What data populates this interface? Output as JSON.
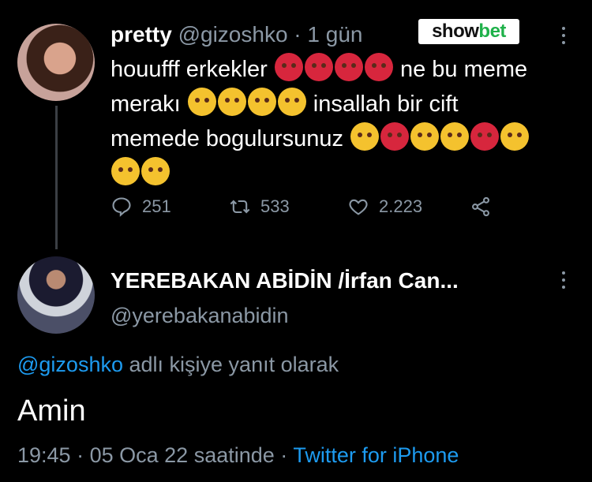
{
  "tweet1": {
    "name": "pretty",
    "handle": "@gizoshko",
    "separator": "·",
    "time": "1 gün",
    "text_1": "houufff erkekler",
    "text_2": "ne bu meme",
    "text_3": "merakı",
    "text_4": "insallah bir cift",
    "text_5": "memede bogulursunuz",
    "stats": {
      "replies": "251",
      "retweets": "533",
      "likes": "2.223"
    }
  },
  "badge": {
    "show": "show",
    "bet": "bet"
  },
  "tweet2": {
    "name": "YEREBAKAN ABİDİN /İrfan Can...",
    "handle": "@yerebakanabidin",
    "reply_mention": "@gizoshko",
    "reply_suffix": "adlı kişiye yanıt olarak",
    "text": "Amin",
    "time": "19:45",
    "dot": "·",
    "date": "05 Oca 22 saatinde",
    "dot2": "·",
    "source": "Twitter for iPhone"
  },
  "icons": [
    "more-icon",
    "reply-icon",
    "retweet-icon",
    "like-icon",
    "share-icon",
    "angry-face-icon",
    "steam-face-icon"
  ],
  "colors": {
    "background": "#000000",
    "muted": "#8b98a5",
    "link": "#1d9bf0",
    "badge_green": "#1fb14a"
  }
}
